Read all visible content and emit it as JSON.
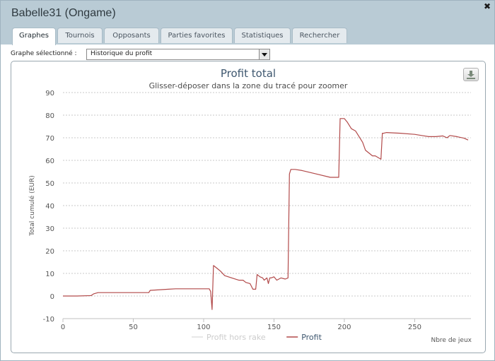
{
  "window": {
    "title": "Babelle31 (Ongame)",
    "close_glyph": "✖"
  },
  "tabs": [
    {
      "label": "Graphes",
      "active": true
    },
    {
      "label": "Tournois",
      "active": false
    },
    {
      "label": "Opposants",
      "active": false
    },
    {
      "label": "Parties favorites",
      "active": false
    },
    {
      "label": "Statistiques",
      "active": false
    },
    {
      "label": "Rechercher",
      "active": false
    }
  ],
  "graph_select": {
    "label": "Graphe sélectionné :",
    "value": "Historique du profit"
  },
  "export_button": {
    "icon": "download-icon"
  },
  "chart_data": {
    "type": "line",
    "title": "Profit total",
    "subtitle": "Glisser-déposer dans la zone du tracé pour zoomer",
    "xlabel": "Nbre de jeux",
    "ylabel": "Total cumulé (EUR)",
    "xlim": [
      0,
      290
    ],
    "ylim": [
      -10,
      90
    ],
    "xticks": [
      0,
      50,
      100,
      150,
      200,
      250
    ],
    "yticks": [
      -10,
      0,
      10,
      20,
      30,
      40,
      50,
      60,
      70,
      80,
      90
    ],
    "grid": true,
    "legend": "bottom-center",
    "series": [
      {
        "name": "Profit hors rake",
        "color": "#e0e0e0",
        "values": []
      },
      {
        "name": "Profit",
        "color": "#b24a4a",
        "x": [
          0,
          10,
          20,
          22,
          25,
          30,
          40,
          50,
          61,
          62,
          70,
          75,
          80,
          90,
          100,
          104,
          105,
          106,
          107,
          108,
          110,
          112,
          115,
          120,
          125,
          128,
          130,
          133,
          135,
          137,
          138,
          139,
          140,
          142,
          143,
          145,
          146,
          147,
          148,
          150,
          152,
          155,
          158,
          160,
          161,
          162,
          165,
          170,
          180,
          190,
          196,
          197,
          200,
          202,
          205,
          208,
          210,
          213,
          215,
          218,
          220,
          222,
          226,
          227,
          228,
          230,
          240,
          250,
          255,
          260,
          265,
          270,
          273,
          275,
          280,
          285,
          288
        ],
        "values": [
          0,
          0,
          0.2,
          1,
          1.5,
          1.5,
          1.5,
          1.5,
          1.5,
          2.5,
          2.8,
          3,
          3.2,
          3.2,
          3.2,
          3.2,
          2,
          -6,
          13.5,
          13,
          12,
          11,
          9,
          8,
          7,
          7,
          6,
          5.5,
          3,
          3,
          9.5,
          9,
          8.5,
          8,
          7,
          8,
          5.5,
          8,
          8,
          8.5,
          7,
          8,
          7.5,
          8,
          54,
          56,
          56,
          55.5,
          54,
          52.5,
          52.5,
          78.5,
          78.5,
          77,
          74,
          73,
          71,
          68,
          64.5,
          63,
          62,
          62,
          60.5,
          72,
          72,
          72.3,
          72,
          71.5,
          71,
          70.5,
          70.5,
          70.8,
          70,
          71,
          70.5,
          69.8,
          69
        ]
      }
    ]
  }
}
